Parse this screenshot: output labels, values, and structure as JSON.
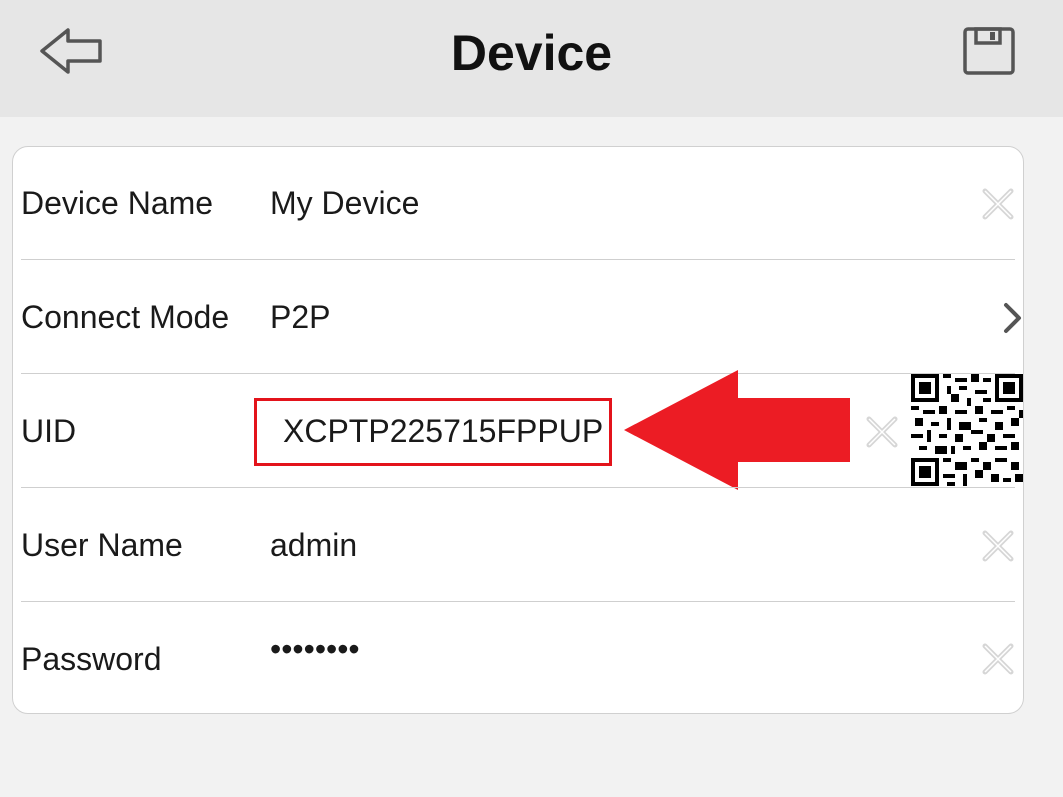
{
  "header": {
    "title": "Device",
    "back_icon": "back-arrow-icon",
    "save_icon": "save-floppy-icon"
  },
  "form": {
    "device_name": {
      "label": "Device Name",
      "value": "My Device"
    },
    "connect_mode": {
      "label": "Connect Mode",
      "value": "P2P"
    },
    "uid": {
      "label": "UID",
      "value": "XCPTP225715FPPUP"
    },
    "user_name": {
      "label": "User Name",
      "value": "admin"
    },
    "password": {
      "label": "Password",
      "value": "••••••••"
    }
  },
  "annotation": {
    "highlight_color": "#e3131b",
    "arrow_color": "#ec1c24"
  },
  "colors": {
    "header_bg": "#e6e6e6",
    "page_bg": "#f2f2f2",
    "icon_gray": "#d0d0d0"
  }
}
